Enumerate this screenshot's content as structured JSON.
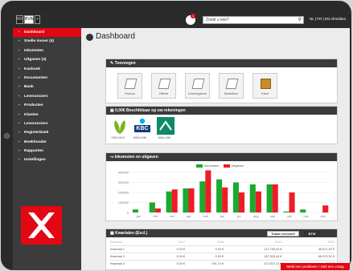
{
  "topbar": {
    "lang_options": [
      "NV",
      "BVBA",
      "+"
    ],
    "notification_count": "1",
    "search_placeholder": "Zoekt u iets?",
    "account_text": "NL | FR | EN  Afmelden"
  },
  "sidebar": {
    "items": [
      {
        "label": "Dashboard",
        "icon": "dashboard-icon",
        "active": true
      },
      {
        "label": "Snelle invoer (4)",
        "icon": "edit-icon"
      },
      {
        "label": "Inkomsten",
        "icon": "income-icon"
      },
      {
        "label": "Uitgaven (3)",
        "icon": "expenses-icon"
      },
      {
        "label": "Kasboek",
        "icon": "cashbook-icon"
      },
      {
        "label": "Documenten",
        "icon": "documents-icon"
      },
      {
        "label": "Bank",
        "icon": "bank-icon"
      },
      {
        "label": "Leveranciers",
        "icon": "supplier-icon"
      },
      {
        "label": "Producten",
        "icon": "product-icon"
      },
      {
        "label": "Klanten",
        "icon": "customers-icon"
      },
      {
        "label": "Leveranciers",
        "icon": "suppliers-icon"
      },
      {
        "label": "Registerboek",
        "icon": "register-icon"
      },
      {
        "label": "Boekhouder",
        "icon": "accountant-icon"
      },
      {
        "label": "Rapporten",
        "icon": "reports-icon"
      },
      {
        "label": "Instellingen",
        "icon": "settings-icon"
      }
    ]
  },
  "page": {
    "title": "Dashboard"
  },
  "quick_add": {
    "title": "Toevoegen",
    "tiles": [
      "Factuur",
      "Offerte",
      "Leveringsbon",
      "Bestelbon",
      "Klant"
    ]
  },
  "accounts": {
    "title": "0,00€ Beschikbaar op uw rekeningen",
    "items": [
      {
        "bank": "bank-1",
        "amount": "7990,00 €"
      },
      {
        "bank": "KBC",
        "amount": "8990,00€"
      },
      {
        "bank": "bank-3",
        "amount": "1964,00€"
      }
    ]
  },
  "income_chart_panel": {
    "title": "Inkomsten en uitgaven"
  },
  "chart_data": {
    "type": "bar",
    "title": "",
    "xlabel": "",
    "ylabel": "",
    "categories": [
      "jan",
      "feb",
      "mrt",
      "apr",
      "mei",
      "jun",
      "jul",
      "aug",
      "sep",
      "okt",
      "nov",
      "dec"
    ],
    "series": [
      {
        "name": "Inkomsten",
        "color": "#1aaa2e",
        "values": [
          30000,
          100000,
          210000,
          240000,
          310000,
          330000,
          300000,
          280000,
          280000,
          10000,
          30000,
          0
        ]
      },
      {
        "name": "Uitgaven",
        "color": "#ee1c25",
        "values": [
          0,
          40000,
          230000,
          240000,
          420000,
          250000,
          200000,
          210000,
          280000,
          200000,
          0,
          70000
        ]
      }
    ],
    "ylim": [
      0,
      400000
    ],
    "yticks": [
      "400000",
      "300000",
      "200000",
      "100000",
      "0"
    ],
    "grid": true,
    "legend": "top-center"
  },
  "quarters": {
    "title": "Kwartalen (Excl.)",
    "buttons": [
      "Totaal exclusief",
      "BTW"
    ],
    "columns": [
      "Kwartaal",
      "2017",
      "2018",
      "2019",
      "2020"
    ],
    "rows": [
      [
        "Kwartaal 1",
        "0,00 €",
        "0,00 €",
        "112.700,00 €",
        "36.871,02 €"
      ],
      [
        "Kwartaal 2",
        "0,00 €",
        "0,00 €",
        "187.528,44 €",
        "56.570,31 €"
      ],
      [
        "Kwartaal 3",
        "0,00 €",
        "291,74 €",
        "472.521,12 €",
        "0,00 €"
      ]
    ]
  },
  "status_message": "Meld een probleem / Stel een vraag"
}
